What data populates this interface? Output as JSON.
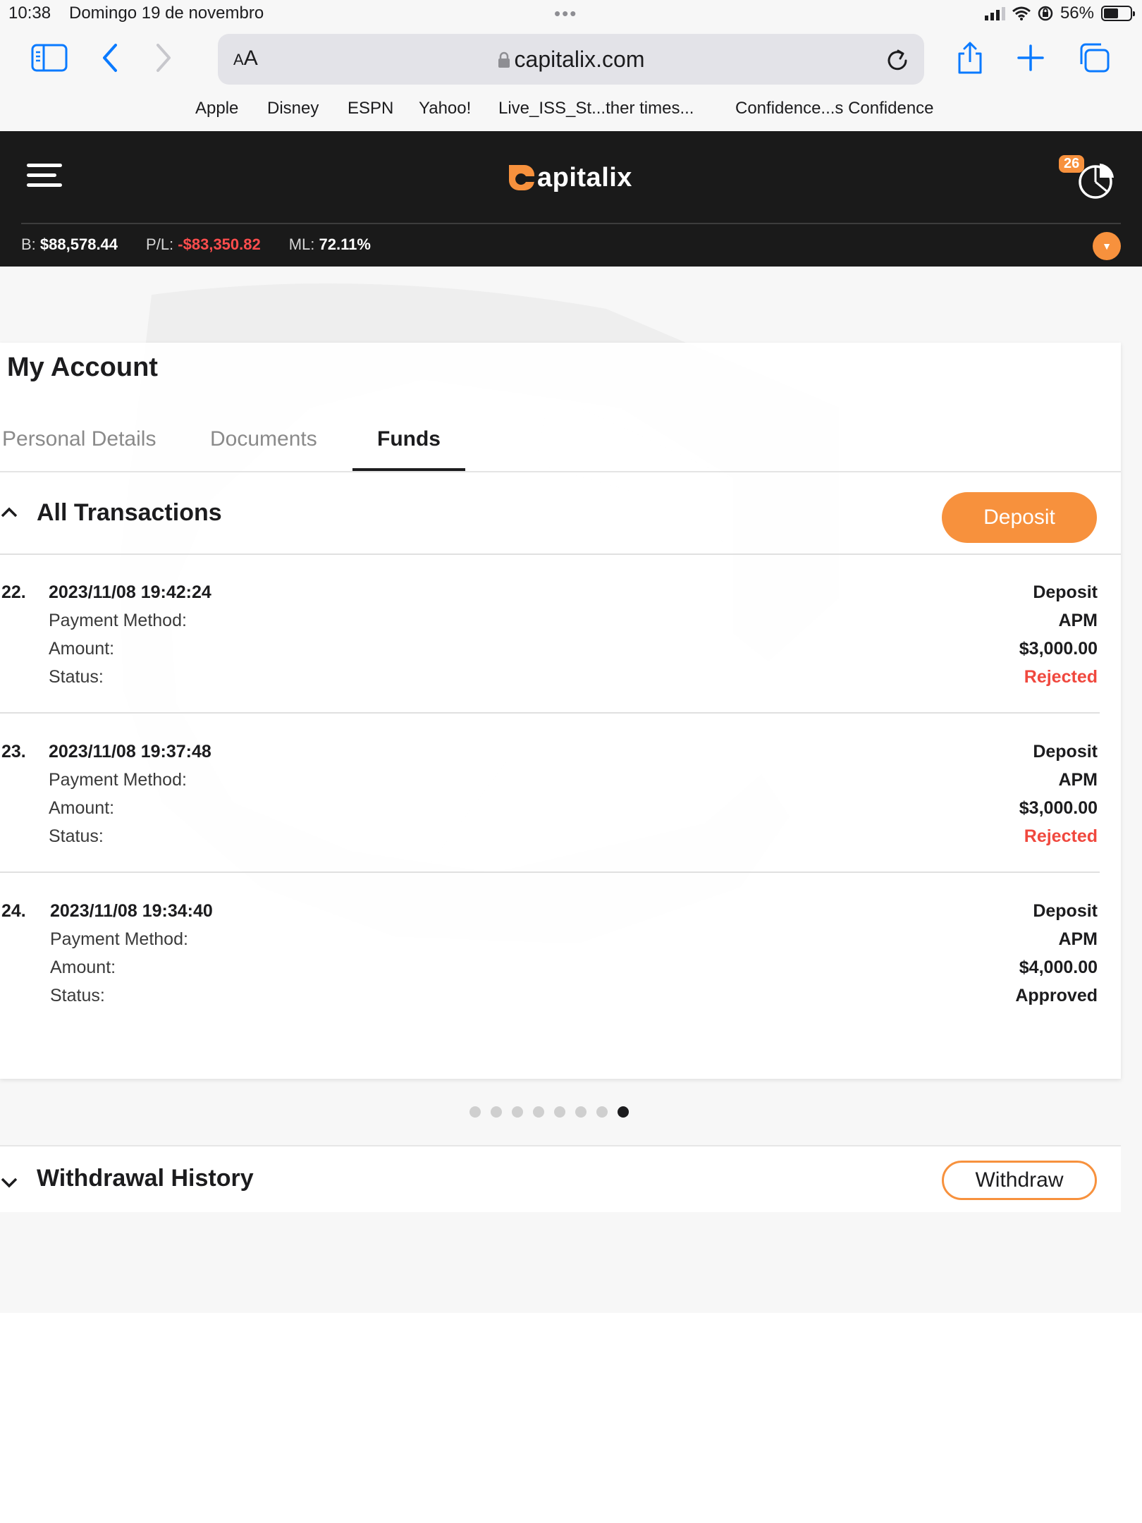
{
  "status_bar": {
    "time": "10:38",
    "date": "Domingo 19 de novembro",
    "battery": "56%"
  },
  "browser": {
    "aa_label": "A",
    "url": "capitalix.com",
    "favorites": [
      "Apple",
      "Disney",
      "ESPN",
      "Yahoo!",
      "Live_ISS_St...ther times...",
      "Confidence...s Confidence"
    ]
  },
  "header": {
    "logo_text": "apitalix",
    "notification_count": "26",
    "balance_label": "B:",
    "balance": "$88,578.44",
    "pl_label": "P/L:",
    "pl": "-$83,350.82",
    "ml_label": "ML:",
    "ml": "72.11%"
  },
  "account": {
    "title": "My Account",
    "tabs": [
      "Personal Details",
      "Documents",
      "Funds"
    ],
    "active_tab": "Funds"
  },
  "transactions": {
    "title": "All Transactions",
    "deposit_button": "Deposit",
    "field_labels": {
      "payment_method": "Payment Method:",
      "amount": "Amount:",
      "status": "Status:"
    },
    "items": [
      {
        "num": "22.",
        "datetime": "2023/11/08 19:42:24",
        "type": "Deposit",
        "method": "APM",
        "amount": "$3,000.00",
        "status": "Rejected"
      },
      {
        "num": "23.",
        "datetime": "2023/11/08 19:37:48",
        "type": "Deposit",
        "method": "APM",
        "amount": "$3,000.00",
        "status": "Rejected"
      },
      {
        "num": "24.",
        "datetime": "2023/11/08 19:34:40",
        "type": "Deposit",
        "method": "APM",
        "amount": "$4,000.00",
        "status": "Approved"
      }
    ],
    "pagination": {
      "total_pages": 8,
      "current_page": 8
    }
  },
  "withdrawals": {
    "title": "Withdrawal History",
    "withdraw_button": "Withdraw"
  },
  "colors": {
    "accent": "#f7913d",
    "header_bg": "#1a1a1a",
    "rejected": "#f0483e",
    "negative": "#ff4d4d"
  }
}
